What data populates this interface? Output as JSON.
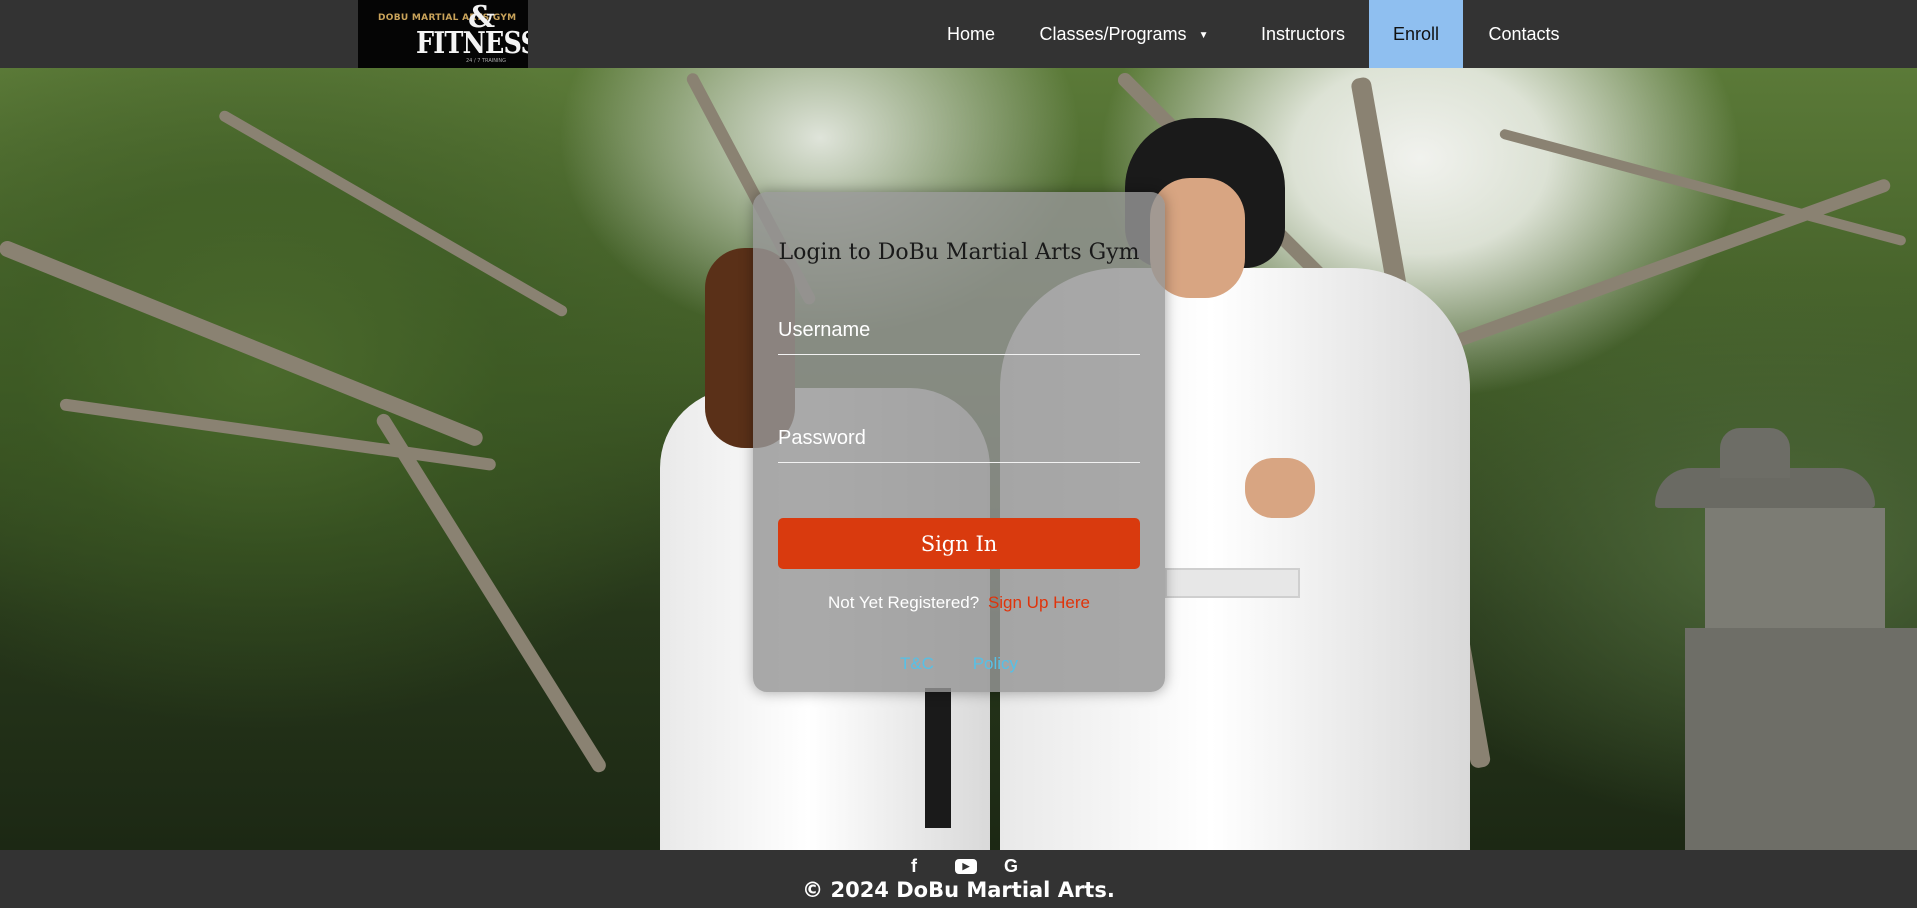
{
  "logo": {
    "line1": "DOBU MARTIAL ARTS GYM",
    "ampersand": "&",
    "line2": "FITNESS",
    "line3": "24 / 7 TRAINING"
  },
  "nav": {
    "items": [
      {
        "label": "Home"
      },
      {
        "label": "Classes/Programs",
        "has_dropdown": true
      },
      {
        "label": "Instructors"
      },
      {
        "label": "Enroll",
        "active": true
      },
      {
        "label": "Contacts"
      }
    ],
    "caret": "▼"
  },
  "login": {
    "title": "Login to DoBu Martial Arts Gym",
    "username_placeholder": "Username",
    "password_placeholder": "Password",
    "signin_label": "Sign In",
    "register_prompt": "Not Yet Registered?",
    "register_link": "Sign Up Here",
    "tc_link": "T&C",
    "policy_link": "Policy"
  },
  "footer": {
    "socials": [
      {
        "icon": "facebook-icon",
        "glyph": "f"
      },
      {
        "icon": "youtube-icon",
        "glyph": "▶"
      },
      {
        "icon": "google-icon",
        "glyph": "G"
      }
    ],
    "copyright": "© 2024 DoBu Martial Arts."
  },
  "colors": {
    "navbar": "#333333",
    "active_nav": "#8fbff0",
    "signin_button": "#d93a0e",
    "register_link": "#e0330a",
    "footer_links": "#56c0e6"
  }
}
